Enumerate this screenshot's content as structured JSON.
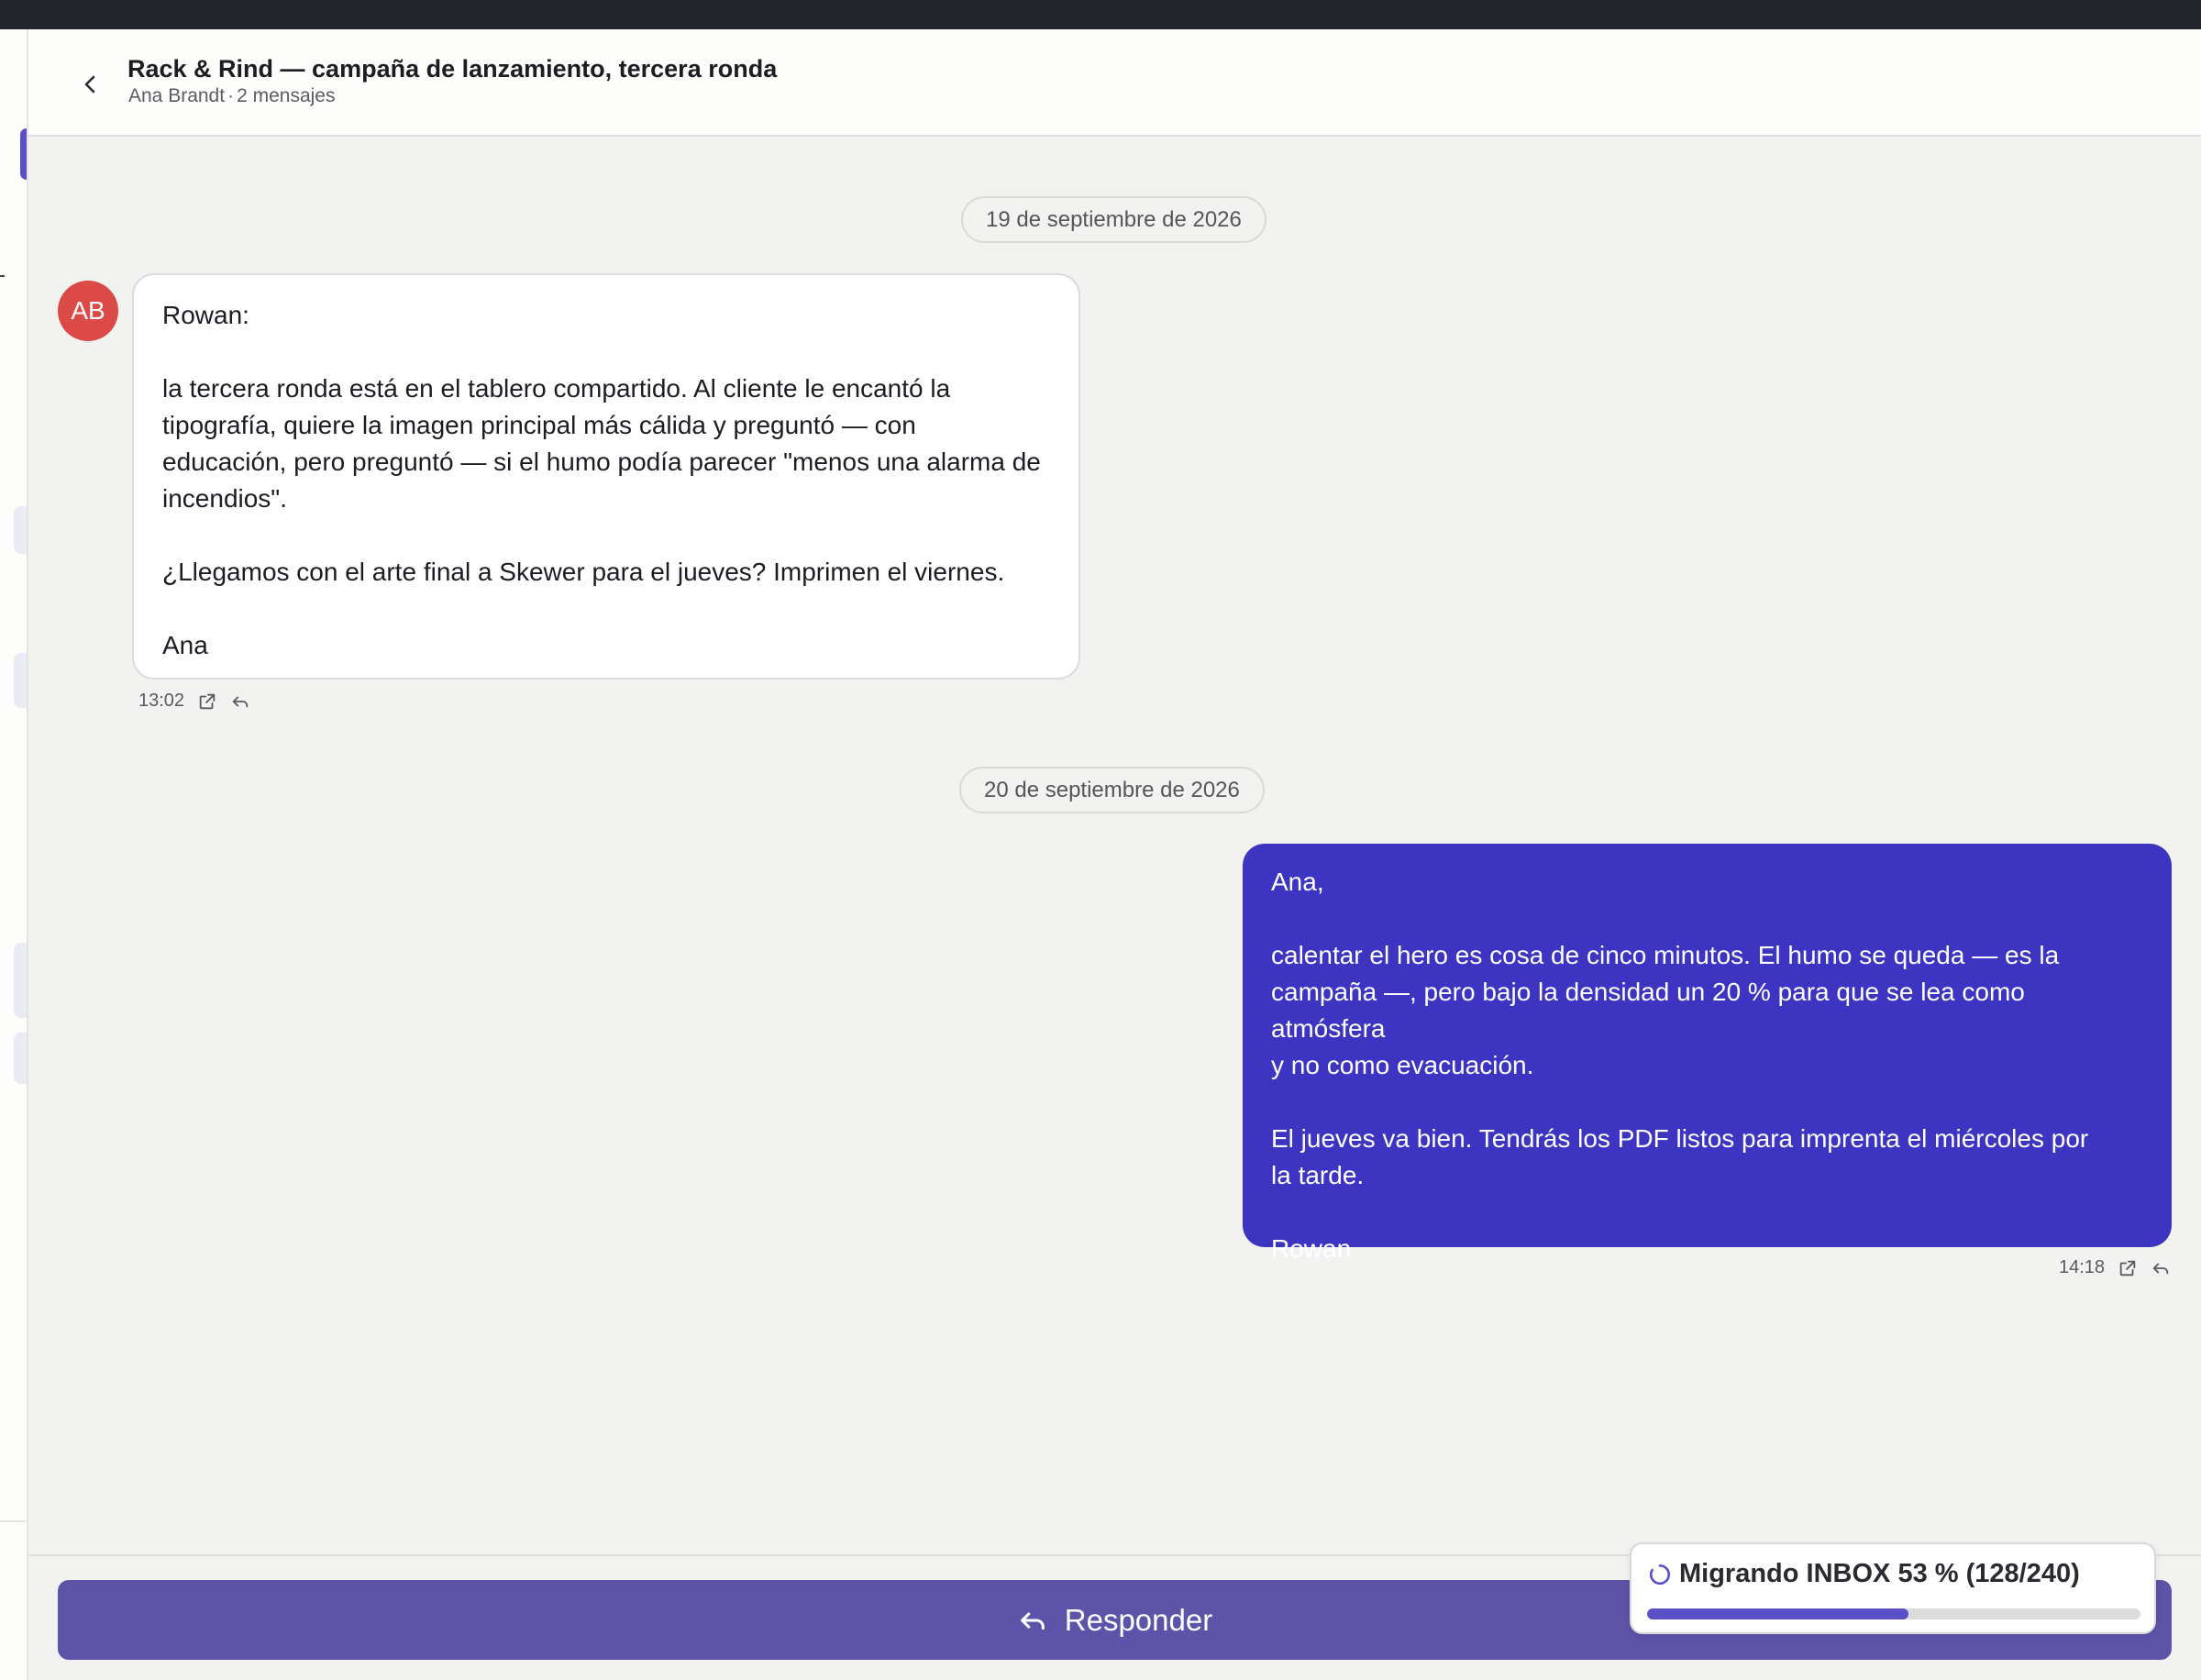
{
  "thread": {
    "title": "Rack & Rind — campaña de lanzamiento, tercera ronda",
    "sender": "Ana Brandt",
    "separator": "·",
    "count": "2 mensajes"
  },
  "messages": [
    {
      "date": "19 de septiembre de 2026",
      "avatar_initials": "AB",
      "avatar_color": "#dc4a47",
      "direction": "incoming",
      "lines": [
        "Rowan:",
        "",
        "la tercera ronda está en el tablero compartido. Al cliente le encantó la",
        "tipografía, quiere la imagen principal más cálida y preguntó — con",
        "educación, pero preguntó — si el humo podía parecer \"menos una alarma de",
        "incendios\".",
        "",
        "¿Llegamos con el arte final a Skewer para el jueves? Imprimen el viernes.",
        "",
        "Ana"
      ],
      "time": "13:02"
    },
    {
      "date": "20 de septiembre de 2026",
      "direction": "outgoing",
      "bubble_color": "#3d35c2",
      "lines": [
        "Ana,",
        "",
        "calentar el hero es cosa de cinco minutos. El humo se queda — es la",
        "campaña —, pero bajo la densidad un 20 % para que se lea como atmósfera",
        "y no como evacuación.",
        "",
        "El jueves va bien. Tendrás los PDF listos para imprenta el miércoles por",
        "la tarde.",
        "",
        "Rowan"
      ],
      "time": "14:18"
    }
  ],
  "icons": {
    "back": "chevron-left-icon",
    "open": "external-link-icon",
    "reply": "reply-arrow-icon",
    "spinner": "spinner-icon"
  },
  "composer": {
    "reply_label": "Responder",
    "button_color": "#5d53a8"
  },
  "migration": {
    "label": "Migrando INBOX 53 % (128/240)",
    "progress": 0.53,
    "accent": "#5b4fc7"
  }
}
